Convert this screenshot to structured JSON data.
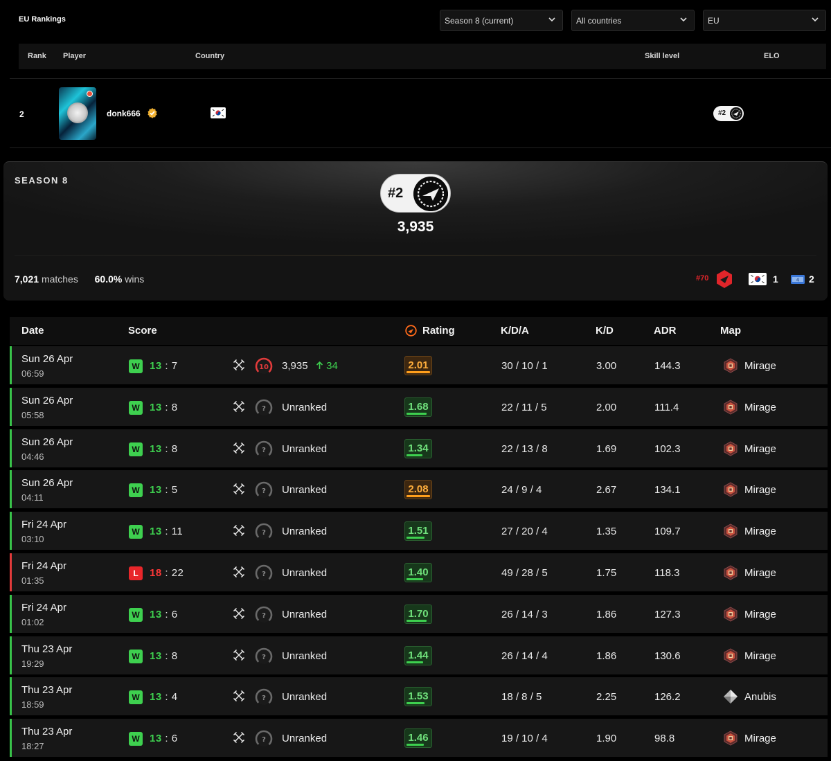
{
  "header": {
    "title": "EU Rankings",
    "filters": {
      "season": "Season 8 (current)",
      "country": "All countries",
      "region": "EU"
    }
  },
  "ranking_table": {
    "columns": [
      "Rank",
      "Player",
      "Country",
      "Skill level",
      "ELO"
    ],
    "row": {
      "rank": "2",
      "player": "donk666",
      "country_flag": "south-korea-flag",
      "elo_badge": "#2"
    }
  },
  "season_card": {
    "title": "SEASON 8",
    "rank_badge": "#2",
    "elo": "3,935",
    "matches_value": "7,021",
    "matches_label": "matches",
    "wins_value": "60.0%",
    "wins_label": "wins",
    "world_rank": "#70",
    "country_rank": "1",
    "region_rank": "2"
  },
  "matches_table": {
    "columns": {
      "date": "Date",
      "score": "Score",
      "rating": "Rating",
      "kda": "K/D/A",
      "kd": "K/D",
      "adr": "ADR",
      "map": "Map"
    },
    "rows": [
      {
        "date": "Sun 26 Apr",
        "time": "06:59",
        "result": "W",
        "own": "13",
        "opp": "7",
        "skill": "10",
        "elo": "3,935",
        "elo_change": "34",
        "rating": "2.01",
        "rating_level": 1.0,
        "kda": "30 / 10 / 1",
        "kd": "3.00",
        "adr": "144.3",
        "map": "Mirage"
      },
      {
        "date": "Sun 26 Apr",
        "time": "05:58",
        "result": "W",
        "own": "13",
        "opp": "8",
        "skill": "?",
        "elo": "Unranked",
        "elo_change": "",
        "rating": "1.68",
        "rating_level": 0.84,
        "kda": "22 / 11 / 5",
        "kd": "2.00",
        "adr": "111.4",
        "map": "Mirage"
      },
      {
        "date": "Sun 26 Apr",
        "time": "04:46",
        "result": "W",
        "own": "13",
        "opp": "8",
        "skill": "?",
        "elo": "Unranked",
        "elo_change": "",
        "rating": "1.34",
        "rating_level": 0.67,
        "kda": "22 / 13 / 8",
        "kd": "1.69",
        "adr": "102.3",
        "map": "Mirage"
      },
      {
        "date": "Sun 26 Apr",
        "time": "04:11",
        "result": "W",
        "own": "13",
        "opp": "5",
        "skill": "?",
        "elo": "Unranked",
        "elo_change": "",
        "rating": "2.08",
        "rating_level": 1.0,
        "kda": "24 / 9 / 4",
        "kd": "2.67",
        "adr": "134.1",
        "map": "Mirage"
      },
      {
        "date": "Fri 24 Apr",
        "time": "03:10",
        "result": "W",
        "own": "13",
        "opp": "11",
        "skill": "?",
        "elo": "Unranked",
        "elo_change": "",
        "rating": "1.51",
        "rating_level": 0.75,
        "kda": "27 / 20 / 4",
        "kd": "1.35",
        "adr": "109.7",
        "map": "Mirage"
      },
      {
        "date": "Fri 24 Apr",
        "time": "01:35",
        "result": "L",
        "own": "18",
        "opp": "22",
        "skill": "?",
        "elo": "Unranked",
        "elo_change": "",
        "rating": "1.40",
        "rating_level": 0.7,
        "kda": "49 / 28 / 5",
        "kd": "1.75",
        "adr": "118.3",
        "map": "Mirage"
      },
      {
        "date": "Fri 24 Apr",
        "time": "01:02",
        "result": "W",
        "own": "13",
        "opp": "6",
        "skill": "?",
        "elo": "Unranked",
        "elo_change": "",
        "rating": "1.70",
        "rating_level": 0.85,
        "kda": "26 / 14 / 3",
        "kd": "1.86",
        "adr": "127.3",
        "map": "Mirage"
      },
      {
        "date": "Thu 23 Apr",
        "time": "19:29",
        "result": "W",
        "own": "13",
        "opp": "8",
        "skill": "?",
        "elo": "Unranked",
        "elo_change": "",
        "rating": "1.44",
        "rating_level": 0.72,
        "kda": "26 / 14 / 4",
        "kd": "1.86",
        "adr": "130.6",
        "map": "Mirage"
      },
      {
        "date": "Thu 23 Apr",
        "time": "18:59",
        "result": "W",
        "own": "13",
        "opp": "4",
        "skill": "?",
        "elo": "Unranked",
        "elo_change": "",
        "rating": "1.53",
        "rating_level": 0.76,
        "kda": "18 / 8 / 5",
        "kd": "2.25",
        "adr": "126.2",
        "map": "Anubis"
      },
      {
        "date": "Thu 23 Apr",
        "time": "18:27",
        "result": "W",
        "own": "13",
        "opp": "6",
        "skill": "?",
        "elo": "Unranked",
        "elo_change": "",
        "rating": "1.46",
        "rating_level": 0.73,
        "kda": "19 / 10 / 4",
        "kd": "1.90",
        "adr": "98.8",
        "map": "Mirage"
      }
    ]
  },
  "colors": {
    "win": "#3ed04f",
    "loss": "#e8262a",
    "rating_high": "#ff9f1c",
    "background": "#000000",
    "row": "#171717"
  }
}
